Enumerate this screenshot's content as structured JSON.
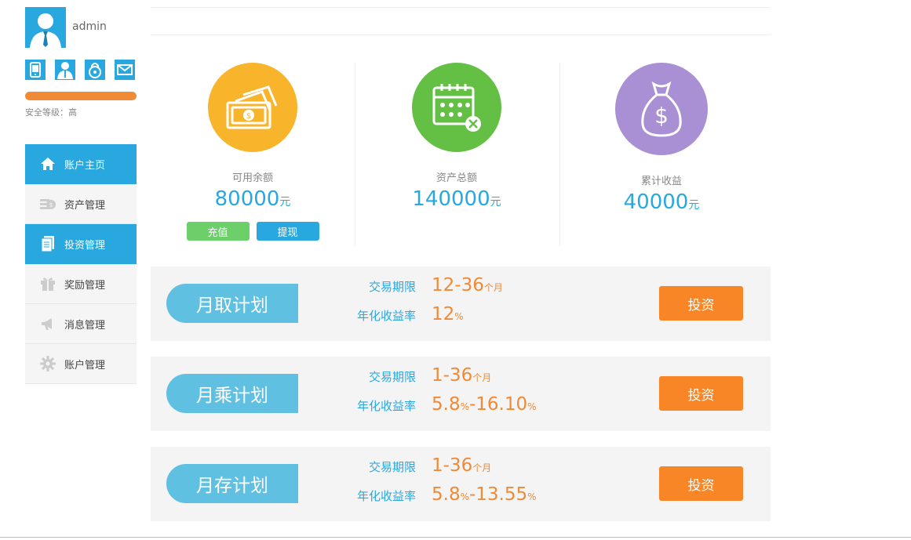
{
  "user": {
    "name": "admin"
  },
  "security": {
    "label": "安全等级：高",
    "level": 1.0
  },
  "menu": [
    {
      "label": "账户主页",
      "active": true,
      "icon": "home-icon"
    },
    {
      "label": "资产管理",
      "active": false,
      "icon": "coins-icon"
    },
    {
      "label": "投资管理",
      "active": true,
      "icon": "document-icon"
    },
    {
      "label": "奖励管理",
      "active": false,
      "icon": "gift-icon"
    },
    {
      "label": "消息管理",
      "active": false,
      "icon": "horn-icon"
    },
    {
      "label": "账户管理",
      "active": false,
      "icon": "gear-icon"
    }
  ],
  "stats": {
    "balance": {
      "label": "可用余额",
      "value": "80000",
      "unit": "元",
      "color": "#f8b42a"
    },
    "assets": {
      "label": "资产总额",
      "value": "140000",
      "unit": "元",
      "color": "#64bf45"
    },
    "earnings": {
      "label": "累计收益",
      "value": "40000",
      "unit": "元",
      "color": "#a98fd3"
    }
  },
  "actions": {
    "recharge": "充值",
    "withdraw": "提现"
  },
  "plans": [
    {
      "name": "月取计划",
      "term_label": "交易期限",
      "term_value": "12-36",
      "term_unit": "个月",
      "rate_label": "年化收益率",
      "rate_a": "12",
      "rate_a_unit": "%",
      "rate_b": "",
      "rate_b_unit": "",
      "button": "投资"
    },
    {
      "name": "月乘计划",
      "term_label": "交易期限",
      "term_value": "1-36",
      "term_unit": "个月",
      "rate_label": "年化收益率",
      "rate_a": "5.8",
      "rate_a_unit": "%",
      "rate_b": "-16.10",
      "rate_b_unit": "%",
      "button": "投资"
    },
    {
      "name": "月存计划",
      "term_label": "交易期限",
      "term_value": "1-36",
      "term_unit": "个月",
      "rate_label": "年化收益率",
      "rate_a": "5.8",
      "rate_a_unit": "%",
      "rate_b": "-13.55",
      "rate_b_unit": "%",
      "button": "投资"
    }
  ],
  "colors": {
    "accent": "#29a8e0",
    "orange": "#f08a36",
    "button": "#f88526",
    "tag": "#5fc0e2"
  }
}
